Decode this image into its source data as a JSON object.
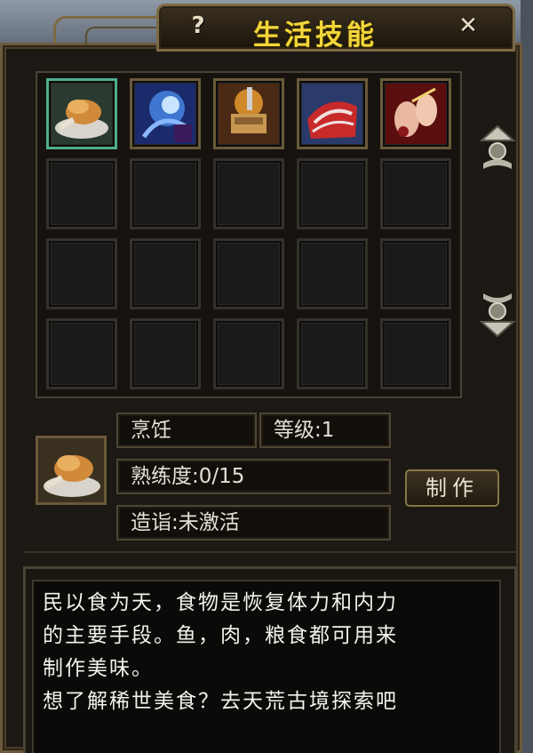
{
  "window": {
    "title": "生活技能",
    "help_icon": "?",
    "close_icon": "✕"
  },
  "skills": [
    {
      "name": "cooking-skill-icon",
      "selected": true
    },
    {
      "name": "spirit-skill-icon",
      "selected": false
    },
    {
      "name": "forging-skill-icon",
      "selected": false
    },
    {
      "name": "tailoring-skill-icon",
      "selected": false
    },
    {
      "name": "crafting-skill-icon",
      "selected": false
    }
  ],
  "info": {
    "skill_name": "烹饪",
    "level": "等级:1",
    "proficiency": "熟练度:0/15",
    "mastery": "造诣:未激活",
    "make_button": "制作"
  },
  "description": {
    "line1": "民以食为天，食物是恢复体力和内力",
    "line2": "的主要手段。鱼，肉，粮食都可用来",
    "line3": "制作美味。",
    "line4": "想了解稀世美食？去天荒古境探索吧"
  },
  "colors": {
    "title": "#f2d63a",
    "frame": "#6b5a3c",
    "selected_border": "#4fae8c"
  }
}
